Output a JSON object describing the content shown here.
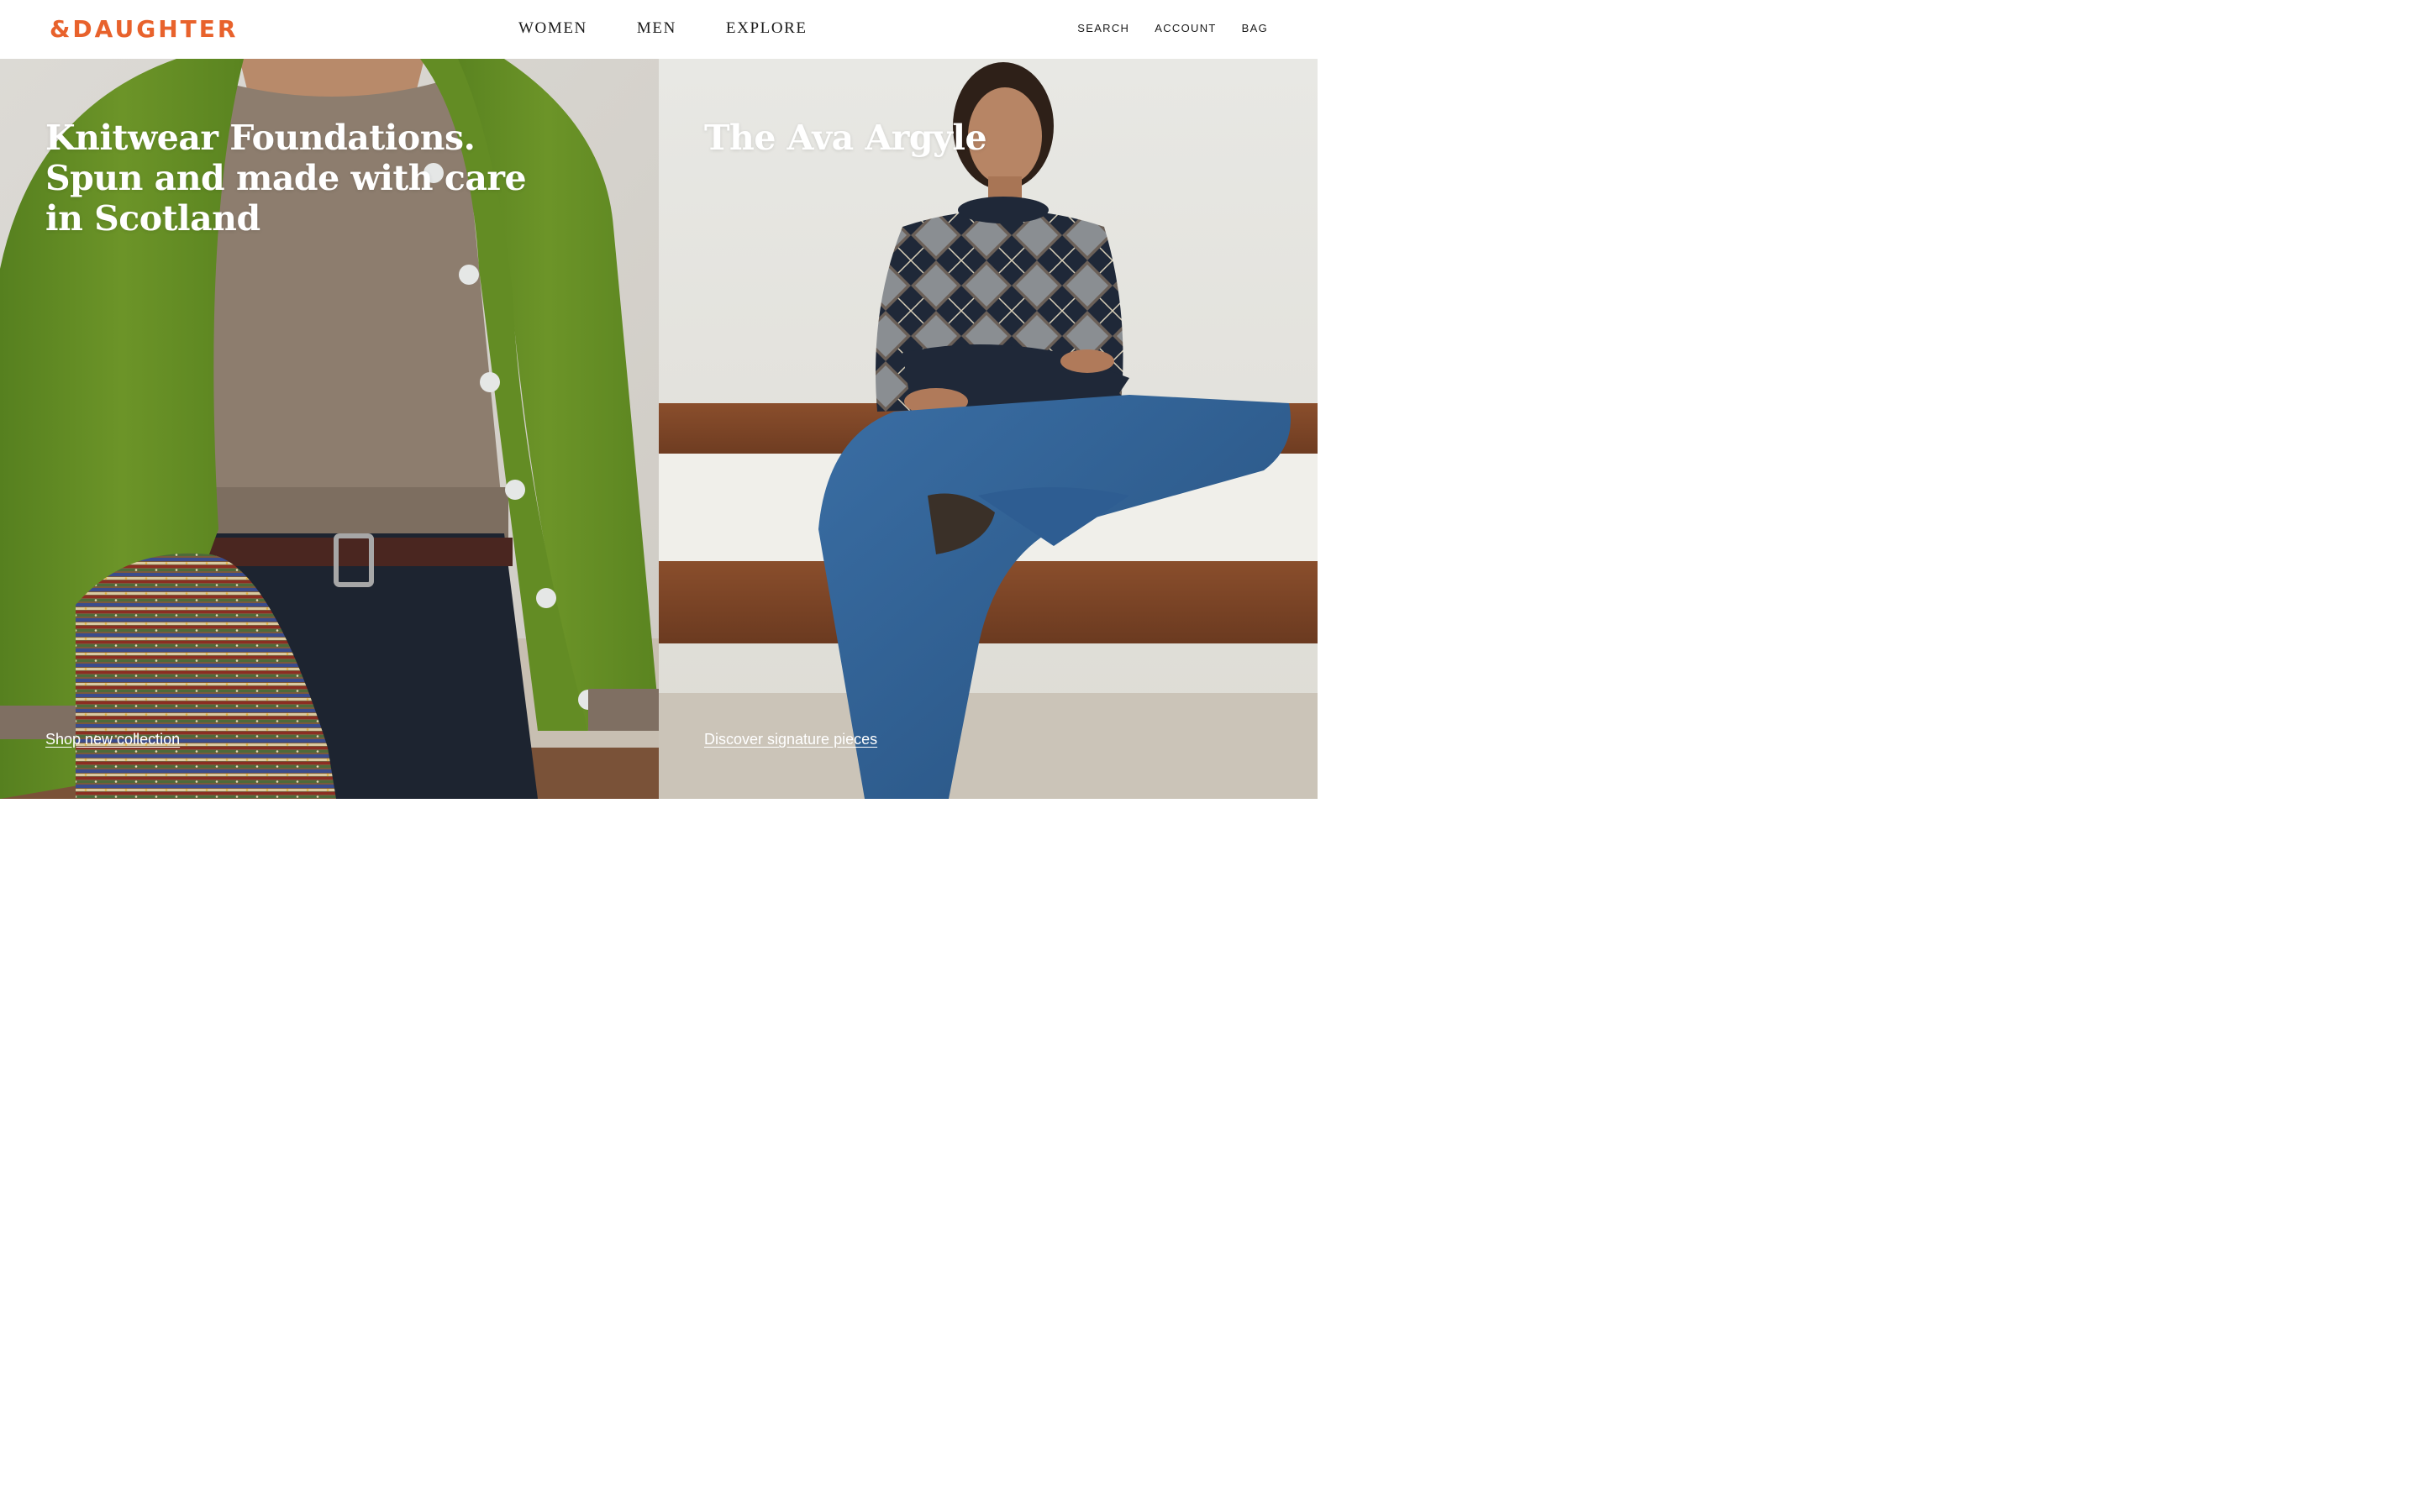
{
  "header": {
    "logo": "&DAUGHTER",
    "main_nav": [
      {
        "label": "WOMEN"
      },
      {
        "label": "MEN"
      },
      {
        "label": "EXPLORE"
      }
    ],
    "utility_nav": [
      {
        "label": "SEARCH"
      },
      {
        "label": "ACCOUNT"
      },
      {
        "label": "BAG"
      }
    ]
  },
  "hero": {
    "panels": [
      {
        "title": "Knitwear Foundations. Spun and made with care in Scotland",
        "link": "Shop new collection"
      },
      {
        "title": "The Ava Argyle",
        "link": "Discover signature pieces"
      }
    ]
  },
  "colors": {
    "brand": "#e8622c",
    "text": "#1a1a1a",
    "overlay_text": "#ffffff"
  }
}
